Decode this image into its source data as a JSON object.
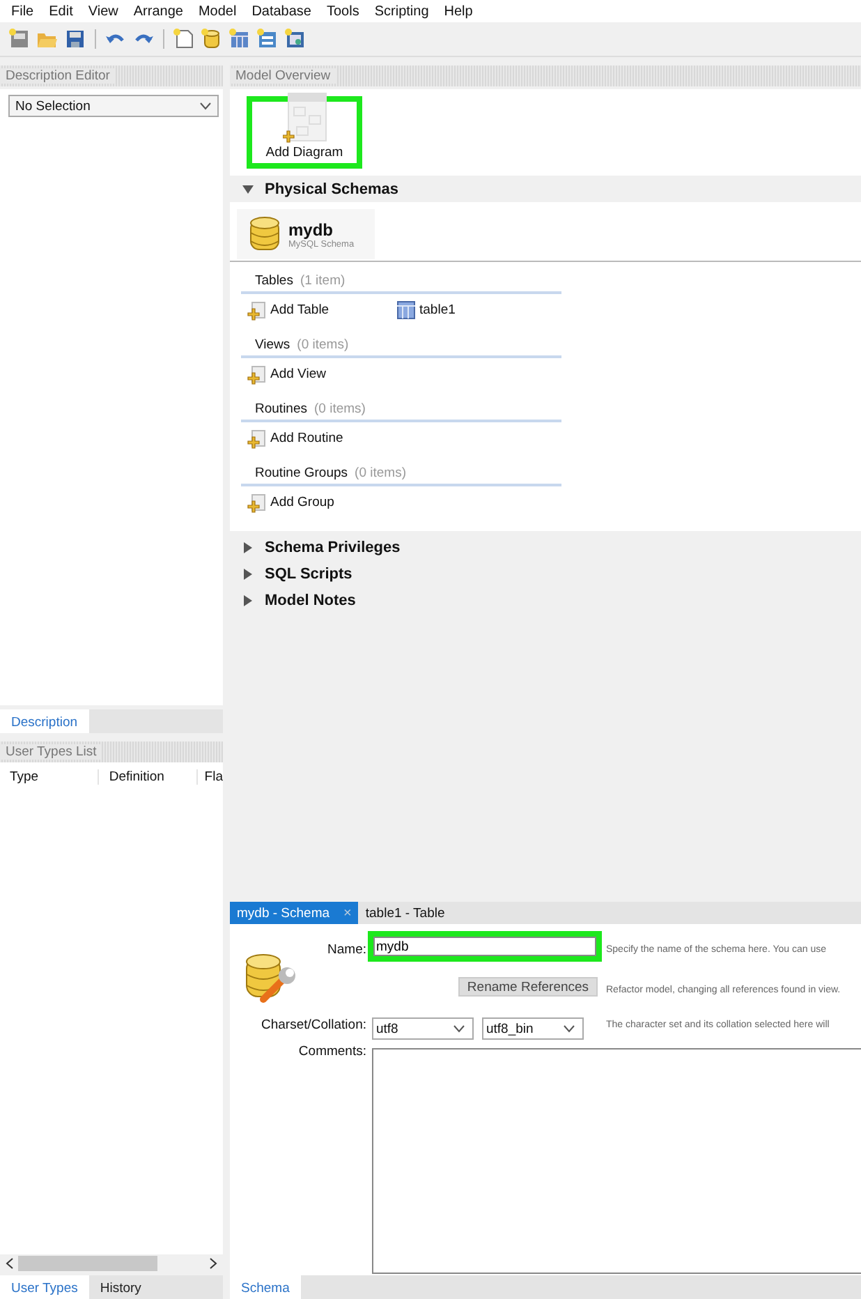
{
  "menu": [
    "File",
    "Edit",
    "View",
    "Arrange",
    "Model",
    "Database",
    "Tools",
    "Scripting",
    "Help"
  ],
  "description_editor": {
    "title": "Description Editor",
    "selector": "No Selection",
    "tabs": [
      {
        "label": "Description",
        "selected": true
      }
    ]
  },
  "user_types": {
    "title": "User Types List",
    "columns": [
      "Type",
      "Definition",
      "Fla"
    ],
    "tabs": [
      {
        "label": "User Types",
        "selected": true
      },
      {
        "label": "History",
        "selected": false
      }
    ]
  },
  "model_overview": {
    "title": "Model Overview",
    "add_diagram": {
      "label": "Add Diagram",
      "highlighted": true
    },
    "sections": [
      {
        "title": "Physical Schemas",
        "expanded": true
      },
      {
        "title": "Schema Privileges",
        "expanded": false
      },
      {
        "title": "SQL Scripts",
        "expanded": false
      },
      {
        "title": "Model Notes",
        "expanded": false
      }
    ],
    "schema": {
      "name": "mydb",
      "subtitle": "MySQL Schema",
      "groups": [
        {
          "title": "Tables",
          "count": "(1 item)",
          "items": [
            {
              "kind": "add",
              "label": "Add Table"
            },
            {
              "kind": "table",
              "label": "table1"
            }
          ]
        },
        {
          "title": "Views",
          "count": "(0 items)",
          "items": [
            {
              "kind": "add",
              "label": "Add View"
            }
          ]
        },
        {
          "title": "Routines",
          "count": "(0 items)",
          "items": [
            {
              "kind": "add",
              "label": "Add Routine"
            }
          ]
        },
        {
          "title": "Routine Groups",
          "count": "(0 items)",
          "items": [
            {
              "kind": "add",
              "label": "Add Group"
            }
          ]
        }
      ]
    }
  },
  "editor": {
    "tabs": [
      {
        "label": "mydb - Schema",
        "selected": true,
        "close": "×"
      },
      {
        "label": "table1 - Table",
        "selected": false
      }
    ],
    "name": {
      "label": "Name:",
      "value": "mydb",
      "highlighted": true,
      "hint": "Specify the name of the schema here. You can use"
    },
    "rename": {
      "label": "Rename References",
      "hint": "Refactor model, changing all references found in view."
    },
    "charset": {
      "label": "Charset/Collation:",
      "charset": "utf8",
      "collation": "utf8_bin",
      "hint": "The character set and its collation selected here will"
    },
    "comments": {
      "label": "Comments:"
    },
    "bottom_tabs": [
      {
        "label": "Schema",
        "selected": true
      }
    ]
  }
}
